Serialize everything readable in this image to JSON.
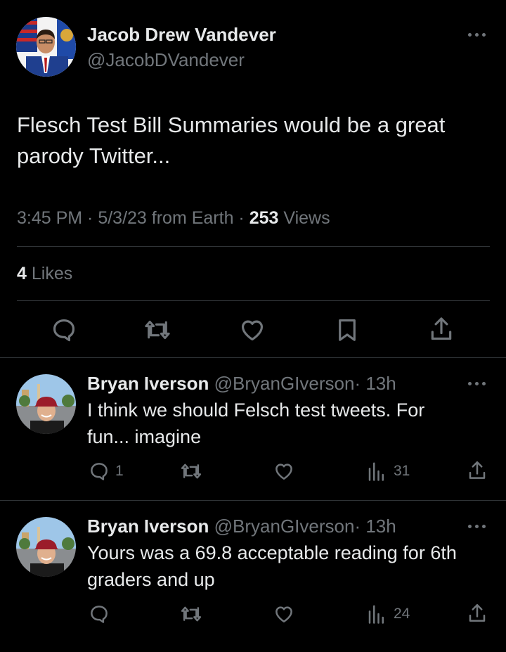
{
  "tweet": {
    "author_name": "Jacob Drew Vandever",
    "author_handle": "@JacobDVandever",
    "text_line1": "Flesch Test Bill Summaries would be a great",
    "text_line2": "parody Twitter...",
    "meta_time": "3:45 PM · 5/3/23 from Earth ·",
    "views_count": "253",
    "views_label": "Views",
    "likes_count": "4",
    "likes_label": "Likes"
  },
  "replies": [
    {
      "author_name": "Bryan Iverson",
      "author_handle": "@BryanGIverson",
      "time": "· 13h",
      "text_line1": "I think we should Felsch test tweets. For",
      "text_line2": "fun... imagine",
      "reply_count": "1",
      "views_count": "31"
    },
    {
      "author_name": "Bryan Iverson",
      "author_handle": "@BryanGIverson",
      "time": "· 13h",
      "text_line1": "Yours was a 69.8 acceptable reading for 6th",
      "text_line2": "graders and up",
      "reply_count": "",
      "views_count": "24"
    }
  ],
  "colors": {
    "background": "#000000",
    "text": "#e7e9ea",
    "secondary": "#71767b",
    "divider": "#2f3336"
  },
  "icons": [
    "more-icon",
    "reply-icon",
    "retweet-icon",
    "like-icon",
    "bookmark-icon",
    "share-icon",
    "views-icon"
  ]
}
